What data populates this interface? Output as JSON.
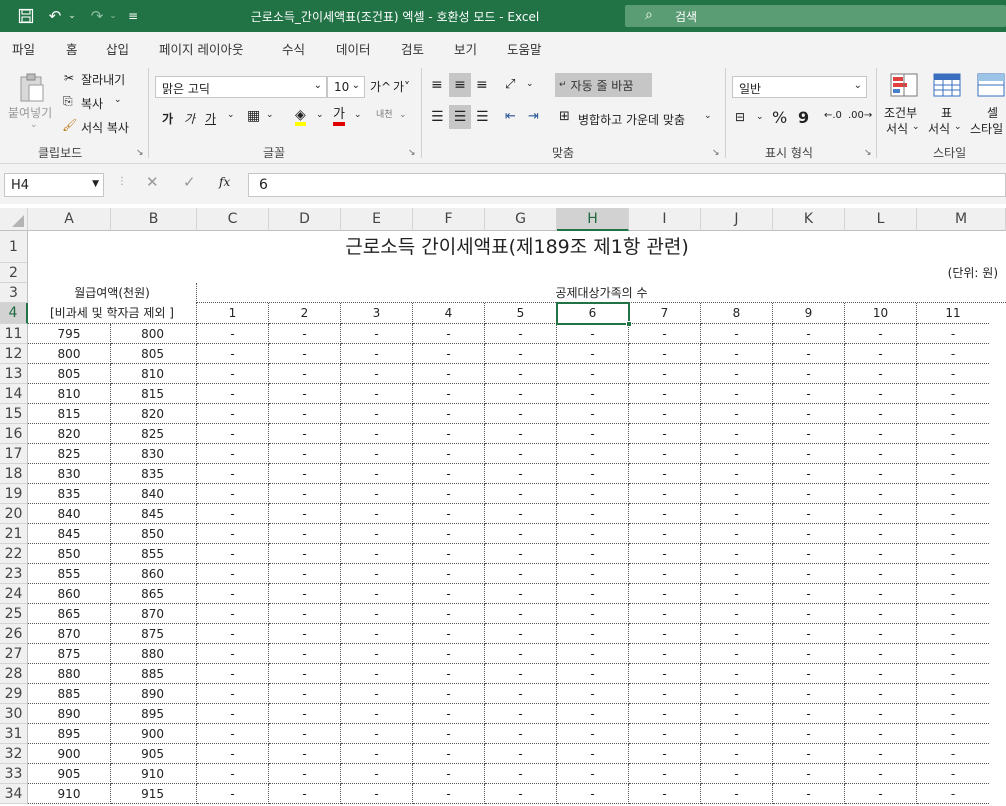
{
  "titlebar": {
    "doc_title": "근로소득_간이세액표(조건표) 엑셀  -  호환성 모드  -  Excel",
    "search_placeholder": "검색",
    "bg_color": "#217346"
  },
  "menu": [
    "파일",
    "홈",
    "삽입",
    "페이지 레이아웃",
    "수식",
    "데이터",
    "검토",
    "보기",
    "도움말"
  ],
  "ribbon": {
    "clipboard": {
      "paste": "붙여넣기",
      "cut": "잘라내기",
      "copy": "복사",
      "format_painter": "서식 복사",
      "label": "클립보드"
    },
    "font": {
      "name": "맑은 고딕",
      "size": "10",
      "grow": "가^",
      "shrink": "가˅",
      "bold": "가",
      "italic": "가",
      "underline": "가",
      "label": "글꼴"
    },
    "alignment": {
      "wrap": "자동 줄 바꿈",
      "merge": "병합하고 가운데 맞춤",
      "label": "맞춤"
    },
    "number": {
      "format": "일반",
      "percent": "%",
      "comma": "9",
      "label": "표시 형식"
    },
    "styles": {
      "conditional": "조건부",
      "conditional2": "서식",
      "table": "표",
      "table2": "서식",
      "cell": "셀",
      "cell2": "스타일",
      "label": "스타일"
    }
  },
  "formula_bar": {
    "name_box": "H4",
    "formula": "6"
  },
  "sheet": {
    "columns": [
      "A",
      "B",
      "C",
      "D",
      "E",
      "F",
      "G",
      "H",
      "I",
      "J",
      "K",
      "L",
      "M"
    ],
    "selected_column": "H",
    "selected_row": "4",
    "title": "근로소득 간이세액표(제189조 제1항 관련)",
    "unit": "(단위: 원)",
    "header_monthly": "월급여액(천원)",
    "header_monthly2": "[비과세 및 학자금 제외 ]",
    "header_dependents": "공제대상가족의 수",
    "dependents": [
      "1",
      "2",
      "3",
      "4",
      "5",
      "6",
      "7",
      "8",
      "9",
      "10",
      "11"
    ],
    "rows": [
      {
        "row": "11",
        "from": "795",
        "to": "800"
      },
      {
        "row": "12",
        "from": "800",
        "to": "805"
      },
      {
        "row": "13",
        "from": "805",
        "to": "810"
      },
      {
        "row": "14",
        "from": "810",
        "to": "815"
      },
      {
        "row": "15",
        "from": "815",
        "to": "820"
      },
      {
        "row": "16",
        "from": "820",
        "to": "825"
      },
      {
        "row": "17",
        "from": "825",
        "to": "830"
      },
      {
        "row": "18",
        "from": "830",
        "to": "835"
      },
      {
        "row": "19",
        "from": "835",
        "to": "840"
      },
      {
        "row": "20",
        "from": "840",
        "to": "845"
      },
      {
        "row": "21",
        "from": "845",
        "to": "850"
      },
      {
        "row": "22",
        "from": "850",
        "to": "855"
      },
      {
        "row": "23",
        "from": "855",
        "to": "860"
      },
      {
        "row": "24",
        "from": "860",
        "to": "865"
      },
      {
        "row": "25",
        "from": "865",
        "to": "870"
      },
      {
        "row": "26",
        "from": "870",
        "to": "875"
      },
      {
        "row": "27",
        "from": "875",
        "to": "880"
      },
      {
        "row": "28",
        "from": "880",
        "to": "885"
      },
      {
        "row": "29",
        "from": "885",
        "to": "890"
      },
      {
        "row": "30",
        "from": "890",
        "to": "895"
      },
      {
        "row": "31",
        "from": "895",
        "to": "900"
      },
      {
        "row": "32",
        "from": "900",
        "to": "905"
      },
      {
        "row": "33",
        "from": "905",
        "to": "910"
      },
      {
        "row": "34",
        "from": "910",
        "to": "915"
      }
    ],
    "empty_value": "-"
  }
}
